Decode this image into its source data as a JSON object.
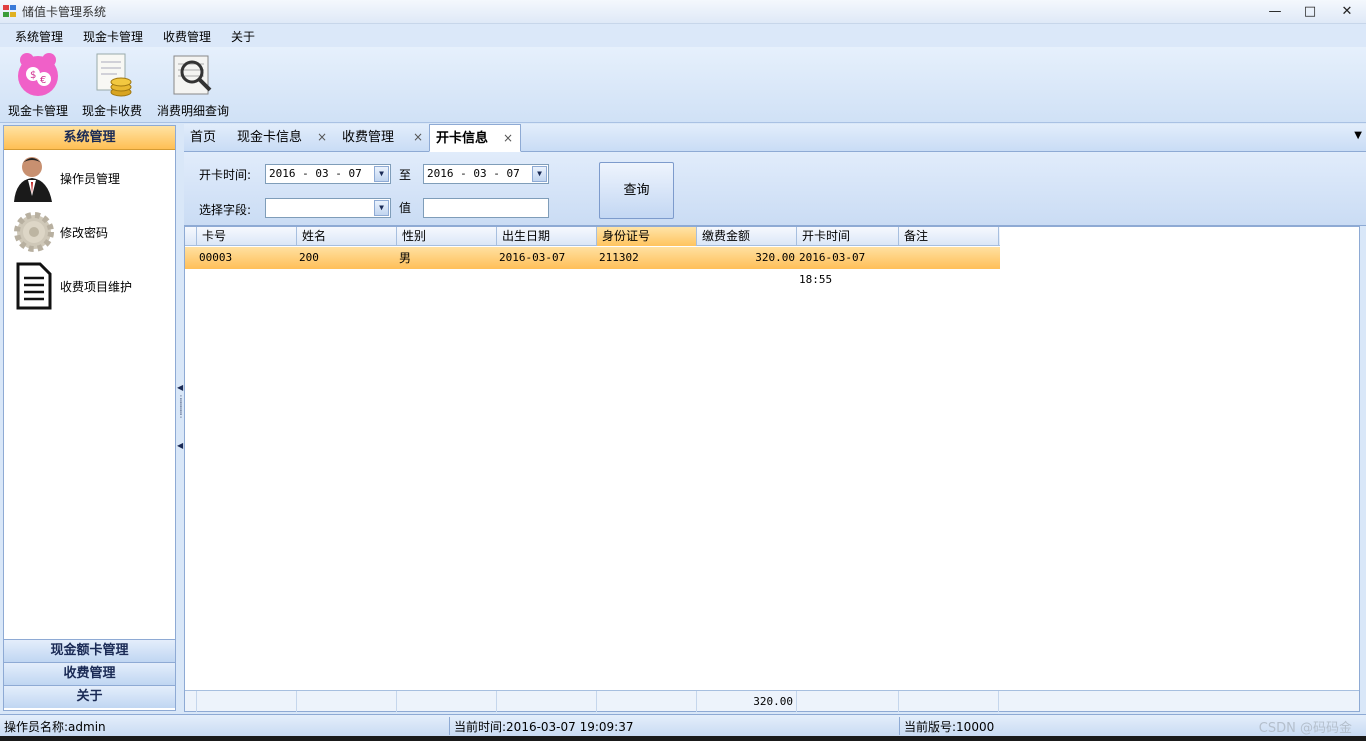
{
  "window": {
    "title": "储值卡管理系统",
    "minimize": "—",
    "maximize": "□",
    "close": "✕"
  },
  "menu": [
    "系统管理",
    "现金卡管理",
    "收费管理",
    "关于"
  ],
  "toolbar": {
    "items": [
      {
        "label": "现金卡管理",
        "icon": "piggy-bank-icon"
      },
      {
        "label": "现金卡收费",
        "icon": "coins-ledger-icon"
      },
      {
        "label": "消费明细查询",
        "icon": "magnifier-document-icon"
      }
    ]
  },
  "sidebar": {
    "header": "系统管理",
    "items": [
      {
        "label": "操作员管理",
        "icon": "operator-user-icon"
      },
      {
        "label": "修改密码",
        "icon": "gear-icon"
      },
      {
        "label": "收费项目维护",
        "icon": "document-icon"
      }
    ],
    "footer": [
      "现金额卡管理",
      "收费管理",
      "关于"
    ]
  },
  "tabs": [
    {
      "label": "首页",
      "closable": false
    },
    {
      "label": "现金卡信息",
      "closable": true
    },
    {
      "label": "收费管理",
      "closable": true
    },
    {
      "label": "开卡信息",
      "closable": true,
      "active": true
    }
  ],
  "tab_close_glyph": "×",
  "query": {
    "open_time_label": "开卡时间:",
    "date_from": "2016 - 03 - 07",
    "to_label": "至",
    "date_to": "2016 - 03 - 07",
    "field_label": "选择字段:",
    "field_value": "",
    "value_label": "值",
    "value_input": "",
    "query_button": "查询"
  },
  "grid": {
    "columns": [
      "卡号",
      "姓名",
      "性别",
      "出生日期",
      "身份证号",
      "缴费金额",
      "开卡时间",
      "备注"
    ],
    "sorted_column": "身份证号",
    "rows": [
      [
        "00003",
        "200",
        "男",
        "2016-03-07",
        "211302",
        "320.00",
        "2016-03-07 18:55",
        ""
      ]
    ],
    "footer_total": "320.00"
  },
  "status": {
    "operator": "操作员名称:admin",
    "time": "当前时间:2016-03-07 19:09:37",
    "version": "当前版号:10000"
  },
  "watermark": "CSDN @码码金",
  "colors": {
    "selected_row": "#ffc45f",
    "panel_bg": "#d9e7f8",
    "border": "#8eaad4"
  }
}
